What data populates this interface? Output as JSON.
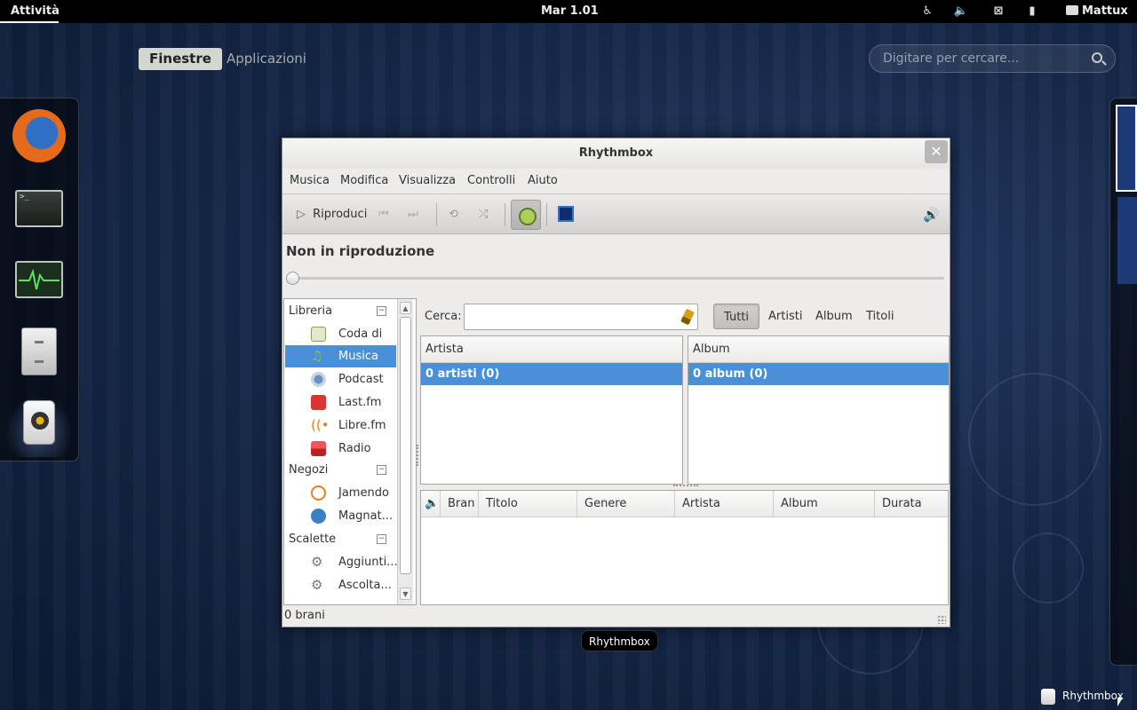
{
  "topbar": {
    "activities": "Attività",
    "clock": "Mar  1.01",
    "user": "Mattux"
  },
  "overview": {
    "tab_windows": "Finestre",
    "tab_apps": "Applicazioni",
    "search_placeholder": "Digitare per cercare..."
  },
  "window": {
    "title": "Rhythmbox",
    "menu": [
      "Musica",
      "Modifica",
      "Visualizza",
      "Controlli",
      "Aiuto"
    ],
    "toolbar": {
      "play_label": "Riproduci"
    },
    "now_playing": "Non in riproduzione",
    "sidebar": {
      "groups": [
        {
          "label": "Libreria",
          "items": [
            {
              "label": "Coda di ...",
              "icon": "queue-icon"
            },
            {
              "label": "Musica",
              "icon": "music-note-icon",
              "selected": true
            },
            {
              "label": "Podcast",
              "icon": "podcast-icon"
            },
            {
              "label": "Last.fm",
              "icon": "lastfm-icon"
            },
            {
              "label": "Libre.fm",
              "icon": "librefm-icon"
            },
            {
              "label": "Radio",
              "icon": "radio-icon"
            }
          ]
        },
        {
          "label": "Negozi",
          "items": [
            {
              "label": "Jamendo",
              "icon": "jamendo-icon"
            },
            {
              "label": "Magnat...",
              "icon": "magnatune-icon"
            }
          ]
        },
        {
          "label": "Scalette",
          "items": [
            {
              "label": "Aggiunti...",
              "icon": "gear-icon"
            },
            {
              "label": "Ascolta...",
              "icon": "gear-icon"
            }
          ]
        }
      ]
    },
    "browser": {
      "search_label": "Cerca:",
      "search_value": "",
      "filters": [
        "Tutti",
        "Artisti",
        "Album",
        "Titoli"
      ],
      "artist_header": "Artista",
      "artist_row": "0 artisti (0)",
      "album_header": "Album",
      "album_row": "0 album (0)",
      "track_columns": [
        "Bran",
        "Titolo",
        "Genere",
        "Artista",
        "Album",
        "Durata"
      ]
    },
    "status": "0 brani"
  },
  "window_label": "Rhythmbox",
  "tray": {
    "label": "Rhythmbox"
  },
  "colors": {
    "selection": "#4a90d9",
    "topbar": "#000000"
  }
}
